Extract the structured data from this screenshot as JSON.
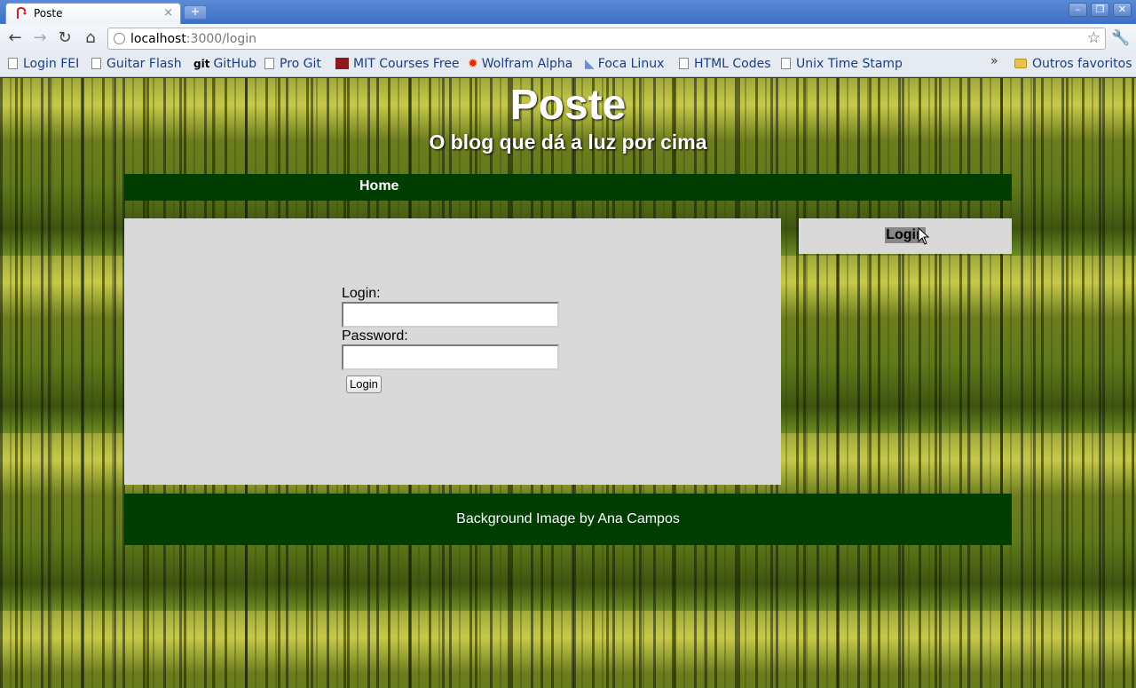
{
  "browser": {
    "tab_title": "Poste",
    "tab_close": "×",
    "new_tab": "+",
    "window_buttons": [
      "–",
      "❐",
      "✕"
    ],
    "url_host": "localhost",
    "url_path": ":3000/login",
    "bookmarks": [
      {
        "label": "Login FEI",
        "icon": "page-icon"
      },
      {
        "label": "Guitar Flash",
        "icon": "page-icon"
      },
      {
        "label": "GitHub",
        "icon": "git-icon",
        "icon_text": "git"
      },
      {
        "label": "Pro Git",
        "icon": "page-icon"
      },
      {
        "label": "MIT Courses Free",
        "icon": "mit-icon"
      },
      {
        "label": "Wolfram Alpha",
        "icon": "wolfram-icon",
        "icon_text": "✹"
      },
      {
        "label": "Foca Linux",
        "icon": "foca-icon",
        "icon_text": "◣"
      },
      {
        "label": "HTML Codes",
        "icon": "page-icon"
      },
      {
        "label": "Unix Time Stamp",
        "icon": "page-icon"
      }
    ],
    "chevron": "»",
    "other_bookmarks": "Outros favoritos"
  },
  "page": {
    "title": "Poste",
    "subtitle": "O blog que dá a luz por cima",
    "menu": {
      "home": "Home"
    },
    "form": {
      "login_label": "Login:",
      "password_label": "Password:",
      "submit_label": "Login"
    },
    "sidebar": {
      "login_link": "Login"
    },
    "footer": "Background Image by Ana Campos"
  },
  "colors": {
    "menu_bg": "#003d00",
    "panel_bg": "#d9d9d9",
    "chrome_blue": "#3c6fc4"
  }
}
